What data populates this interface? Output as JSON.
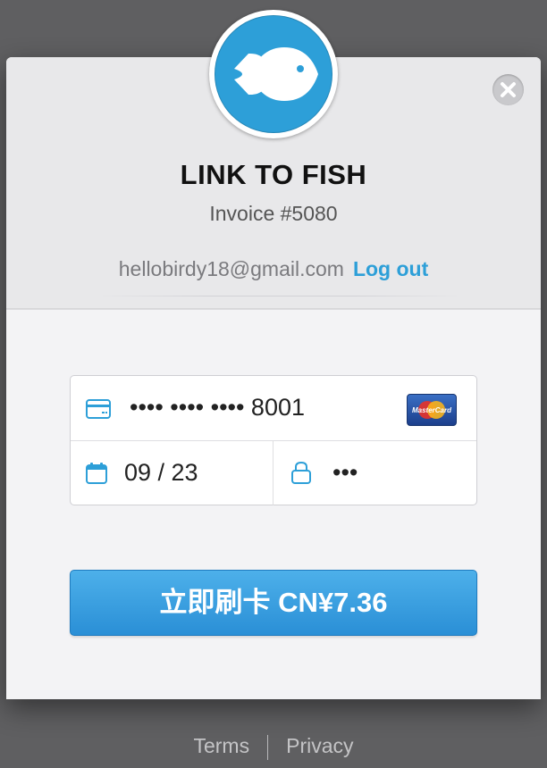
{
  "merchant": {
    "name": "LINK TO FISH",
    "invoice": "Invoice #5080",
    "logo_icon": "fish-icon",
    "brand_color": "#2d9fd8"
  },
  "account": {
    "email": "hellobirdy18@gmail.com",
    "logout_label": "Log out"
  },
  "card": {
    "number_masked": "•••• •••• •••• 8001",
    "brand": "MasterCard",
    "brand_icon": "mastercard-icon",
    "expiry": "09 / 23",
    "cvc_masked": "•••",
    "card_icon": "credit-card-icon",
    "calendar_icon": "calendar-icon",
    "lock_icon": "lock-icon"
  },
  "pay_button": {
    "label": "立即刷卡 CN¥7.36"
  },
  "footer": {
    "terms": "Terms",
    "privacy": "Privacy"
  },
  "close_icon": "close-icon"
}
